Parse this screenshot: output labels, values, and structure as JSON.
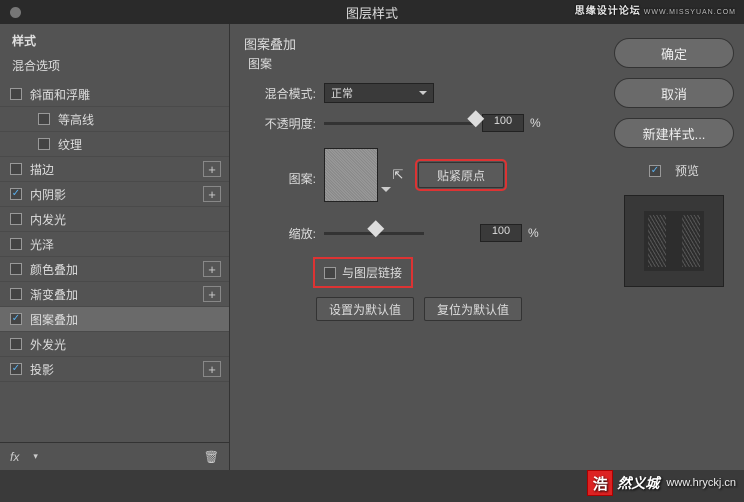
{
  "title": "图层样式",
  "branding": {
    "text": "思缘设计论坛",
    "url": "WWW.MISSYUAN.COM"
  },
  "sidebar": {
    "header": "样式",
    "sub": "混合选项",
    "items": [
      {
        "label": "斜面和浮雕",
        "checked": false,
        "add": false,
        "indent": false
      },
      {
        "label": "等高线",
        "checked": false,
        "add": false,
        "indent": true
      },
      {
        "label": "纹理",
        "checked": false,
        "add": false,
        "indent": true
      },
      {
        "label": "描边",
        "checked": false,
        "add": true,
        "indent": false
      },
      {
        "label": "内阴影",
        "checked": true,
        "add": true,
        "indent": false
      },
      {
        "label": "内发光",
        "checked": false,
        "add": false,
        "indent": false
      },
      {
        "label": "光泽",
        "checked": false,
        "add": false,
        "indent": false
      },
      {
        "label": "颜色叠加",
        "checked": false,
        "add": true,
        "indent": false
      },
      {
        "label": "渐变叠加",
        "checked": false,
        "add": true,
        "indent": false
      },
      {
        "label": "图案叠加",
        "checked": true,
        "add": false,
        "indent": false,
        "selected": true
      },
      {
        "label": "外发光",
        "checked": false,
        "add": false,
        "indent": false
      },
      {
        "label": "投影",
        "checked": true,
        "add": true,
        "indent": false
      }
    ]
  },
  "main": {
    "title": "图案叠加",
    "sub": "图案",
    "blend_mode_label": "混合模式:",
    "blend_mode_value": "正常",
    "opacity_label": "不透明度:",
    "opacity_value": "100",
    "pattern_label": "图案:",
    "snap_label": "贴紧原点",
    "scale_label": "缩放:",
    "scale_value": "100",
    "link_label": "与图层链接",
    "default_set": "设置为默认值",
    "default_reset": "复位为默认值",
    "percent": "%"
  },
  "right": {
    "ok": "确定",
    "cancel": "取消",
    "new_style": "新建样式...",
    "preview": "预览"
  },
  "wm": {
    "badge": "浩",
    "text": "然义城",
    "url": "www.hryckj.cn"
  }
}
